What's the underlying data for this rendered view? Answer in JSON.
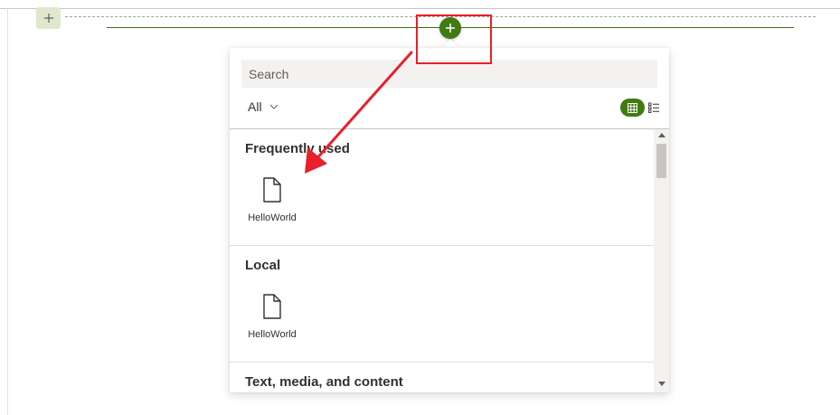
{
  "canvas": {
    "section_add_icon": "plus-icon",
    "add_webpart_icon": "plus-icon"
  },
  "toolbox": {
    "search": {
      "placeholder": "Search",
      "value": ""
    },
    "filter": {
      "label": "All",
      "icon": "chevron-down-icon"
    },
    "view_toggle": {
      "grid_icon": "grid-icon",
      "list_icon": "list-icon"
    },
    "sections": [
      {
        "title": "Frequently used",
        "items": [
          {
            "label": "HelloWorld",
            "icon": "document-icon"
          }
        ]
      },
      {
        "title": "Local",
        "items": [
          {
            "label": "HelloWorld",
            "icon": "document-icon"
          }
        ]
      },
      {
        "title": "Text, media, and content",
        "items": []
      }
    ]
  },
  "colors": {
    "accent_green": "#407a13",
    "section_add_bg": "#dfe8cf",
    "annotation_red": "#e8202a"
  }
}
